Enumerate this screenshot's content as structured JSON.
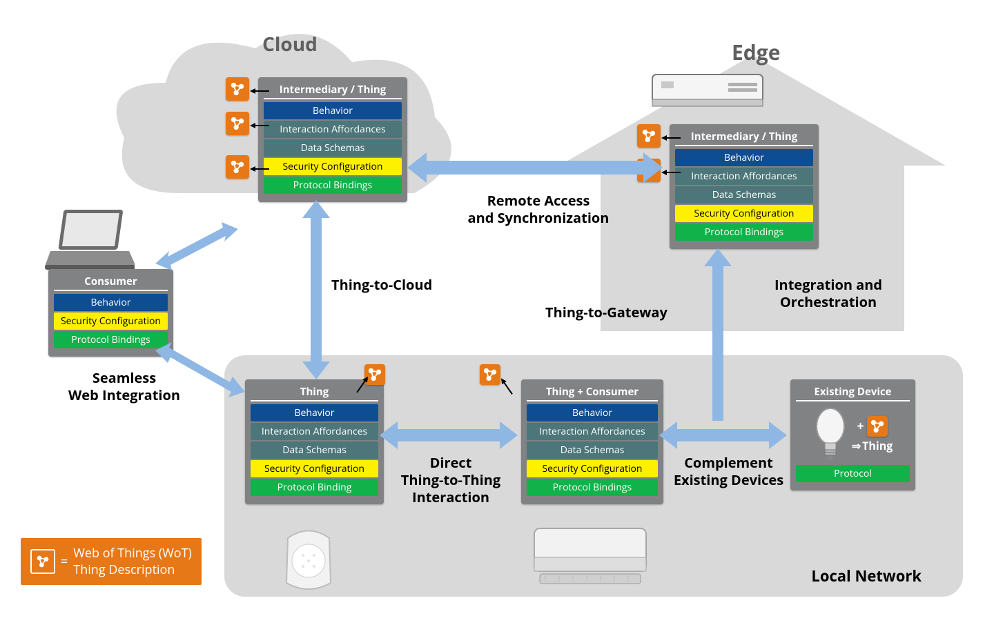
{
  "zones": {
    "cloud": "Cloud",
    "edge": "Edge",
    "local": "Local Network"
  },
  "boxes": {
    "cloud": {
      "title": "Intermediary / Thing",
      "rows": [
        "Behavior",
        "Interaction Affordances",
        "Data Schemas",
        "Security Configuration",
        "Protocol Bindings"
      ]
    },
    "edge": {
      "title": "Intermediary / Thing",
      "rows": [
        "Behavior",
        "Interaction Affordances",
        "Data Schemas",
        "Security Configuration",
        "Protocol Bindings"
      ]
    },
    "consumer": {
      "title": "Consumer",
      "rows": [
        "Behavior",
        "Security Configuration",
        "Protocol Bindings"
      ]
    },
    "thing": {
      "title": "Thing",
      "rows": [
        "Behavior",
        "Interaction Affordances",
        "Data Schemas",
        "Security Configuration",
        "Protocol Binding"
      ]
    },
    "thingConsumer": {
      "title": "Thing + Consumer",
      "rows": [
        "Behavior",
        "Interaction Affordances",
        "Data Schemas",
        "Security Configuration",
        "Protocol Bindings"
      ]
    },
    "existing": {
      "title": "Existing Device",
      "thing_label": "Thing",
      "plus": "+",
      "arrow": "⇒",
      "protocol": "Protocol"
    }
  },
  "conn_labels": {
    "seamless": "Seamless\nWeb Integration",
    "t2c": "Thing-to-Cloud",
    "remote": "Remote Access\nand Synchronization",
    "t2g": "Thing-to-Gateway",
    "integ": "Integration and\nOrchestration",
    "direct": "Direct\nThing-to-Thing\nInteraction",
    "complement": "Complement\nExisting Devices"
  },
  "legend": {
    "eq": "=",
    "text": "Web of Things (WoT)\nThing Description"
  },
  "icons": {
    "td": "td-icon"
  }
}
